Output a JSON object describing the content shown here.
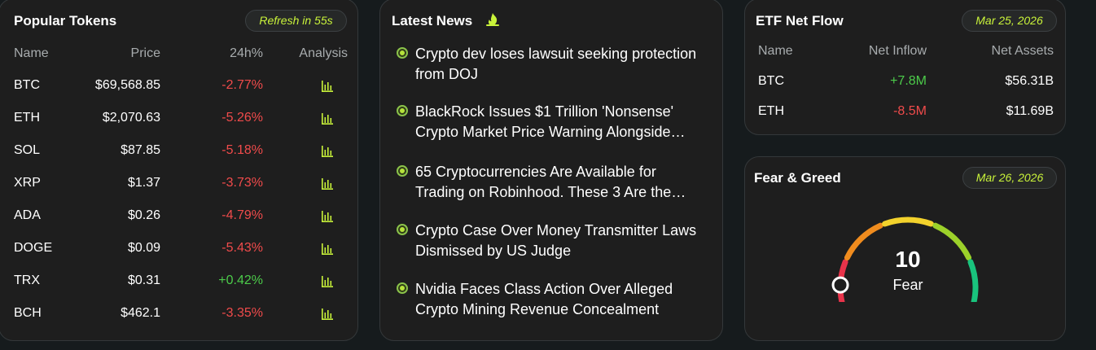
{
  "tokens": {
    "title": "Popular Tokens",
    "refresh": "Refresh in 55s",
    "headers": {
      "name": "Name",
      "price": "Price",
      "change": "24h%",
      "analysis": "Analysis"
    },
    "rows": [
      {
        "name": "BTC",
        "price": "$69,568.85",
        "change": "-2.77%",
        "direction": "neg"
      },
      {
        "name": "ETH",
        "price": "$2,070.63",
        "change": "-5.26%",
        "direction": "neg"
      },
      {
        "name": "SOL",
        "price": "$87.85",
        "change": "-5.18%",
        "direction": "neg"
      },
      {
        "name": "XRP",
        "price": "$1.37",
        "change": "-3.73%",
        "direction": "neg"
      },
      {
        "name": "ADA",
        "price": "$0.26",
        "change": "-4.79%",
        "direction": "neg"
      },
      {
        "name": "DOGE",
        "price": "$0.09",
        "change": "-5.43%",
        "direction": "neg"
      },
      {
        "name": "TRX",
        "price": "$0.31",
        "change": "+0.42%",
        "direction": "pos"
      },
      {
        "name": "BCH",
        "price": "$462.1",
        "change": "-3.35%",
        "direction": "neg"
      }
    ],
    "analysis_icon": "bar-chart-icon"
  },
  "news": {
    "title": "Latest News",
    "title_icon": "fire-icon",
    "items": [
      "Crypto dev loses lawsuit seeking protection from DOJ",
      "BlackRock Issues $1 Trillion 'Nonsense' Crypto Market Price Warning Alongside…",
      "65 Cryptocurrencies Are Available for Trading on Robinhood. These 3 Are the…",
      "Crypto Case Over Money Transmitter Laws Dismissed by US Judge",
      "Nvidia Faces Class Action Over Alleged Crypto Mining Revenue Concealment"
    ]
  },
  "etf": {
    "title": "ETF Net Flow",
    "date": "Mar 25, 2026",
    "headers": {
      "name": "Name",
      "inflow": "Net Inflow",
      "assets": "Net Assets"
    },
    "rows": [
      {
        "name": "BTC",
        "inflow": "+7.8M",
        "assets": "$56.31B",
        "direction": "pos"
      },
      {
        "name": "ETH",
        "inflow": "-8.5M",
        "assets": "$11.69B",
        "direction": "neg"
      }
    ]
  },
  "fear_greed": {
    "title": "Fear & Greed",
    "date": "Mar 26, 2026",
    "value": "10",
    "label": "Fear",
    "index_fraction": 0.1,
    "segment_colors": [
      "#e8334a",
      "#f08c1e",
      "#f3d22c",
      "#9cd12a",
      "#19c37d"
    ]
  },
  "colors": {
    "accent": "#c9f33a",
    "positive": "#4ccb4a",
    "negative": "#f04b4b"
  }
}
